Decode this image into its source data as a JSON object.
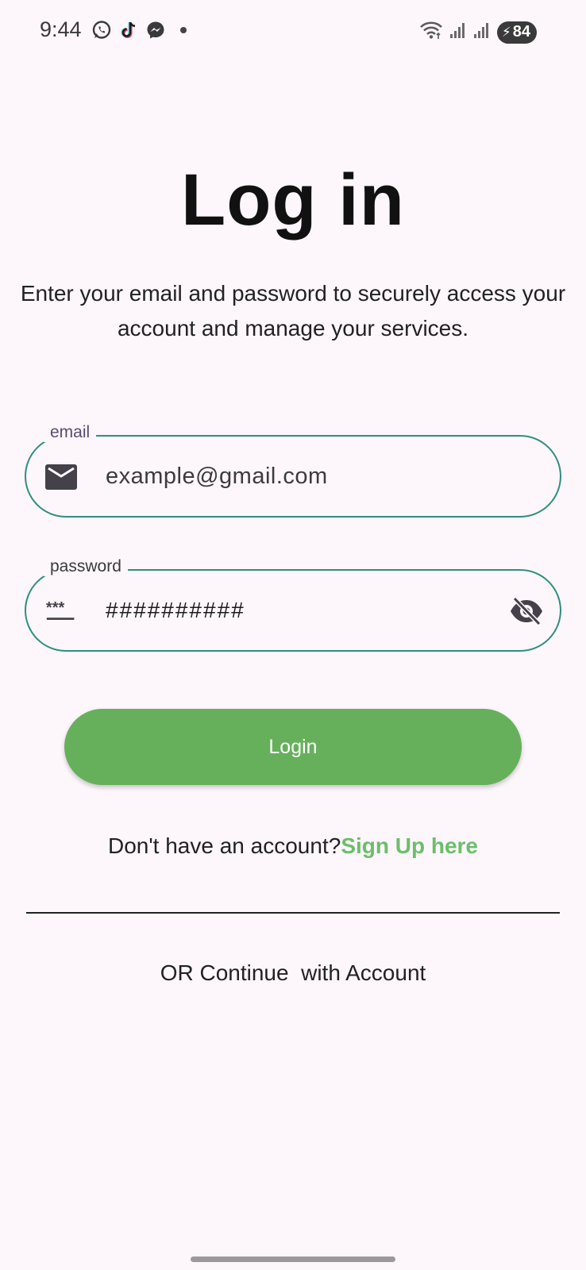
{
  "status_bar": {
    "time": "9:44",
    "battery_level": "84",
    "notification_icons": [
      "whatsapp-icon",
      "tiktok-icon",
      "messenger-icon"
    ]
  },
  "header": {
    "title": "Log in",
    "subtitle": "Enter your email and password to securely access your account and manage your services."
  },
  "form": {
    "email": {
      "label": "email",
      "value": "example@gmail.com",
      "icon": "mail-icon"
    },
    "password": {
      "label": "password",
      "value": "##########",
      "icon": "password-icon",
      "toggle_icon": "visibility-off-icon"
    },
    "login_label": "Login"
  },
  "signup": {
    "prompt": "Don't have an account?",
    "link": "Sign Up here"
  },
  "alternate": {
    "text": "OR Continue  with Account"
  },
  "colors": {
    "background": "#fdf7fc",
    "field_border": "#2f8f7e",
    "primary_button": "#66b05c",
    "link": "#6bbf6a"
  }
}
